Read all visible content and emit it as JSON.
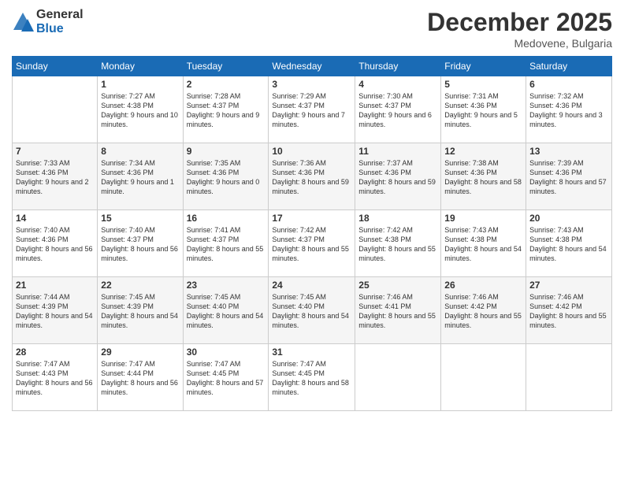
{
  "logo": {
    "general": "General",
    "blue": "Blue"
  },
  "header": {
    "month": "December 2025",
    "location": "Medovene, Bulgaria"
  },
  "days_of_week": [
    "Sunday",
    "Monday",
    "Tuesday",
    "Wednesday",
    "Thursday",
    "Friday",
    "Saturday"
  ],
  "weeks": [
    [
      {
        "day": "",
        "sunrise": "",
        "sunset": "",
        "daylight": ""
      },
      {
        "day": "1",
        "sunrise": "Sunrise: 7:27 AM",
        "sunset": "Sunset: 4:38 PM",
        "daylight": "Daylight: 9 hours and 10 minutes."
      },
      {
        "day": "2",
        "sunrise": "Sunrise: 7:28 AM",
        "sunset": "Sunset: 4:37 PM",
        "daylight": "Daylight: 9 hours and 9 minutes."
      },
      {
        "day": "3",
        "sunrise": "Sunrise: 7:29 AM",
        "sunset": "Sunset: 4:37 PM",
        "daylight": "Daylight: 9 hours and 7 minutes."
      },
      {
        "day": "4",
        "sunrise": "Sunrise: 7:30 AM",
        "sunset": "Sunset: 4:37 PM",
        "daylight": "Daylight: 9 hours and 6 minutes."
      },
      {
        "day": "5",
        "sunrise": "Sunrise: 7:31 AM",
        "sunset": "Sunset: 4:36 PM",
        "daylight": "Daylight: 9 hours and 5 minutes."
      },
      {
        "day": "6",
        "sunrise": "Sunrise: 7:32 AM",
        "sunset": "Sunset: 4:36 PM",
        "daylight": "Daylight: 9 hours and 3 minutes."
      }
    ],
    [
      {
        "day": "7",
        "sunrise": "Sunrise: 7:33 AM",
        "sunset": "Sunset: 4:36 PM",
        "daylight": "Daylight: 9 hours and 2 minutes."
      },
      {
        "day": "8",
        "sunrise": "Sunrise: 7:34 AM",
        "sunset": "Sunset: 4:36 PM",
        "daylight": "Daylight: 9 hours and 1 minute."
      },
      {
        "day": "9",
        "sunrise": "Sunrise: 7:35 AM",
        "sunset": "Sunset: 4:36 PM",
        "daylight": "Daylight: 9 hours and 0 minutes."
      },
      {
        "day": "10",
        "sunrise": "Sunrise: 7:36 AM",
        "sunset": "Sunset: 4:36 PM",
        "daylight": "Daylight: 8 hours and 59 minutes."
      },
      {
        "day": "11",
        "sunrise": "Sunrise: 7:37 AM",
        "sunset": "Sunset: 4:36 PM",
        "daylight": "Daylight: 8 hours and 59 minutes."
      },
      {
        "day": "12",
        "sunrise": "Sunrise: 7:38 AM",
        "sunset": "Sunset: 4:36 PM",
        "daylight": "Daylight: 8 hours and 58 minutes."
      },
      {
        "day": "13",
        "sunrise": "Sunrise: 7:39 AM",
        "sunset": "Sunset: 4:36 PM",
        "daylight": "Daylight: 8 hours and 57 minutes."
      }
    ],
    [
      {
        "day": "14",
        "sunrise": "Sunrise: 7:40 AM",
        "sunset": "Sunset: 4:36 PM",
        "daylight": "Daylight: 8 hours and 56 minutes."
      },
      {
        "day": "15",
        "sunrise": "Sunrise: 7:40 AM",
        "sunset": "Sunset: 4:37 PM",
        "daylight": "Daylight: 8 hours and 56 minutes."
      },
      {
        "day": "16",
        "sunrise": "Sunrise: 7:41 AM",
        "sunset": "Sunset: 4:37 PM",
        "daylight": "Daylight: 8 hours and 55 minutes."
      },
      {
        "day": "17",
        "sunrise": "Sunrise: 7:42 AM",
        "sunset": "Sunset: 4:37 PM",
        "daylight": "Daylight: 8 hours and 55 minutes."
      },
      {
        "day": "18",
        "sunrise": "Sunrise: 7:42 AM",
        "sunset": "Sunset: 4:38 PM",
        "daylight": "Daylight: 8 hours and 55 minutes."
      },
      {
        "day": "19",
        "sunrise": "Sunrise: 7:43 AM",
        "sunset": "Sunset: 4:38 PM",
        "daylight": "Daylight: 8 hours and 54 minutes."
      },
      {
        "day": "20",
        "sunrise": "Sunrise: 7:43 AM",
        "sunset": "Sunset: 4:38 PM",
        "daylight": "Daylight: 8 hours and 54 minutes."
      }
    ],
    [
      {
        "day": "21",
        "sunrise": "Sunrise: 7:44 AM",
        "sunset": "Sunset: 4:39 PM",
        "daylight": "Daylight: 8 hours and 54 minutes."
      },
      {
        "day": "22",
        "sunrise": "Sunrise: 7:45 AM",
        "sunset": "Sunset: 4:39 PM",
        "daylight": "Daylight: 8 hours and 54 minutes."
      },
      {
        "day": "23",
        "sunrise": "Sunrise: 7:45 AM",
        "sunset": "Sunset: 4:40 PM",
        "daylight": "Daylight: 8 hours and 54 minutes."
      },
      {
        "day": "24",
        "sunrise": "Sunrise: 7:45 AM",
        "sunset": "Sunset: 4:40 PM",
        "daylight": "Daylight: 8 hours and 54 minutes."
      },
      {
        "day": "25",
        "sunrise": "Sunrise: 7:46 AM",
        "sunset": "Sunset: 4:41 PM",
        "daylight": "Daylight: 8 hours and 55 minutes."
      },
      {
        "day": "26",
        "sunrise": "Sunrise: 7:46 AM",
        "sunset": "Sunset: 4:42 PM",
        "daylight": "Daylight: 8 hours and 55 minutes."
      },
      {
        "day": "27",
        "sunrise": "Sunrise: 7:46 AM",
        "sunset": "Sunset: 4:42 PM",
        "daylight": "Daylight: 8 hours and 55 minutes."
      }
    ],
    [
      {
        "day": "28",
        "sunrise": "Sunrise: 7:47 AM",
        "sunset": "Sunset: 4:43 PM",
        "daylight": "Daylight: 8 hours and 56 minutes."
      },
      {
        "day": "29",
        "sunrise": "Sunrise: 7:47 AM",
        "sunset": "Sunset: 4:44 PM",
        "daylight": "Daylight: 8 hours and 56 minutes."
      },
      {
        "day": "30",
        "sunrise": "Sunrise: 7:47 AM",
        "sunset": "Sunset: 4:45 PM",
        "daylight": "Daylight: 8 hours and 57 minutes."
      },
      {
        "day": "31",
        "sunrise": "Sunrise: 7:47 AM",
        "sunset": "Sunset: 4:45 PM",
        "daylight": "Daylight: 8 hours and 58 minutes."
      },
      {
        "day": "",
        "sunrise": "",
        "sunset": "",
        "daylight": ""
      },
      {
        "day": "",
        "sunrise": "",
        "sunset": "",
        "daylight": ""
      },
      {
        "day": "",
        "sunrise": "",
        "sunset": "",
        "daylight": ""
      }
    ]
  ]
}
